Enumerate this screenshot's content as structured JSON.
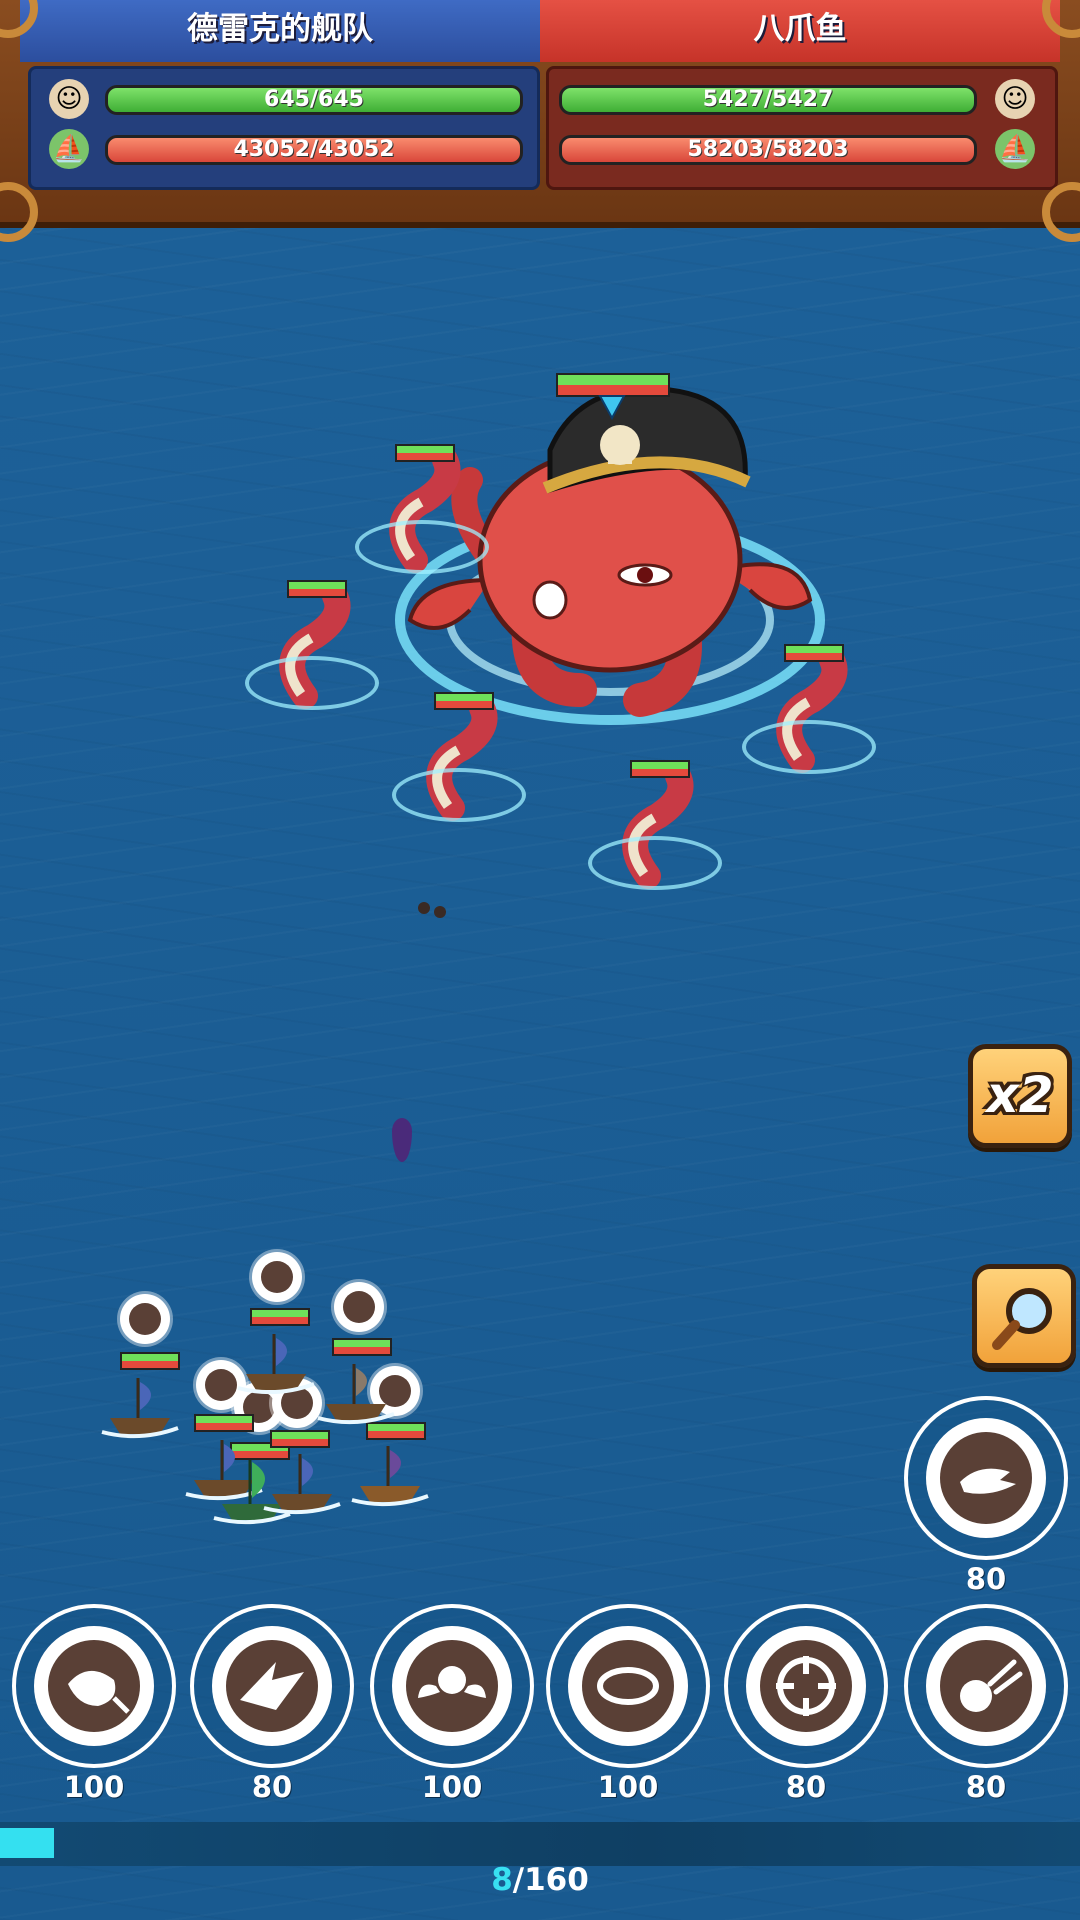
{
  "hud": {
    "left_team": {
      "name": "德雷克的舰队",
      "crew_hp": "645/645",
      "ship_hp": "43052/43052",
      "color": "#2c4e9e"
    },
    "right_team": {
      "name": "八爪鱼",
      "crew_hp": "5427/5427",
      "ship_hp": "58203/58203",
      "color": "#c63329"
    }
  },
  "battle": {
    "boss": "octopus-pirate",
    "tentacle_count": 6,
    "player_ship_count": 8
  },
  "side_buttons": {
    "speed_label": "x2",
    "magnifier_icon": "magnifier-icon"
  },
  "skills": [
    {
      "icon": "wave-shot-icon",
      "cost": "80"
    },
    {
      "icon": "fish-bomb-icon",
      "cost": "100"
    },
    {
      "icon": "shark-icon",
      "cost": "80"
    },
    {
      "icon": "winged-shell-icon",
      "cost": "100"
    },
    {
      "icon": "ring-icon",
      "cost": "100"
    },
    {
      "icon": "crosshair-icon",
      "cost": "80"
    },
    {
      "icon": "cannonball-icon",
      "cost": "80"
    }
  ],
  "energy": {
    "current": "8",
    "max": "/160",
    "fraction": 0.05
  }
}
